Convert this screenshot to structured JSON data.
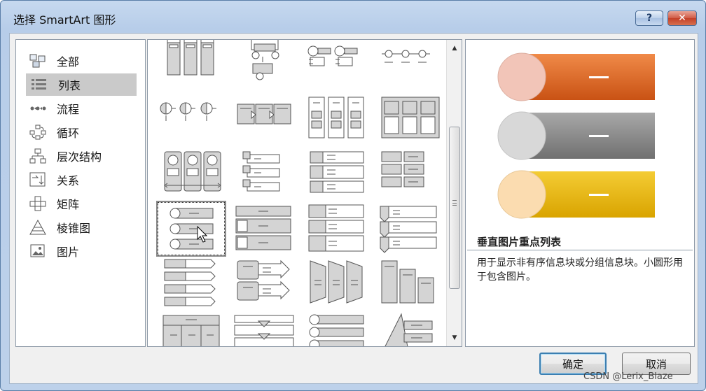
{
  "window": {
    "title": "选择 SmartArt 图形",
    "help_label": "?",
    "close_label": "✕"
  },
  "categories": [
    {
      "label": "全部",
      "icon": "all-icon",
      "selected": false
    },
    {
      "label": "列表",
      "icon": "list-icon",
      "selected": true
    },
    {
      "label": "流程",
      "icon": "process-icon",
      "selected": false
    },
    {
      "label": "循环",
      "icon": "cycle-icon",
      "selected": false
    },
    {
      "label": "层次结构",
      "icon": "hierarchy-icon",
      "selected": false
    },
    {
      "label": "关系",
      "icon": "relationship-icon",
      "selected": false
    },
    {
      "label": "矩阵",
      "icon": "matrix-icon",
      "selected": false
    },
    {
      "label": "棱锥图",
      "icon": "pyramid-icon",
      "selected": false
    },
    {
      "label": "图片",
      "icon": "picture-icon",
      "selected": false
    }
  ],
  "gallery": {
    "selected_layout": "垂直图片重点列表"
  },
  "preview": {
    "title": "垂直图片重点列表",
    "description": "用于显示非有序信息块或分组信息块。小圆形用于包含图片。",
    "colors": [
      "#e4702a",
      "#8c8c8c",
      "#e8b818"
    ],
    "circle_colors": [
      "#f2c5b8",
      "#d8d8d8",
      "#fbdcb0"
    ]
  },
  "buttons": {
    "ok": "确定",
    "cancel": "取消"
  },
  "watermark": "CSDN @Lerix_Blaze"
}
